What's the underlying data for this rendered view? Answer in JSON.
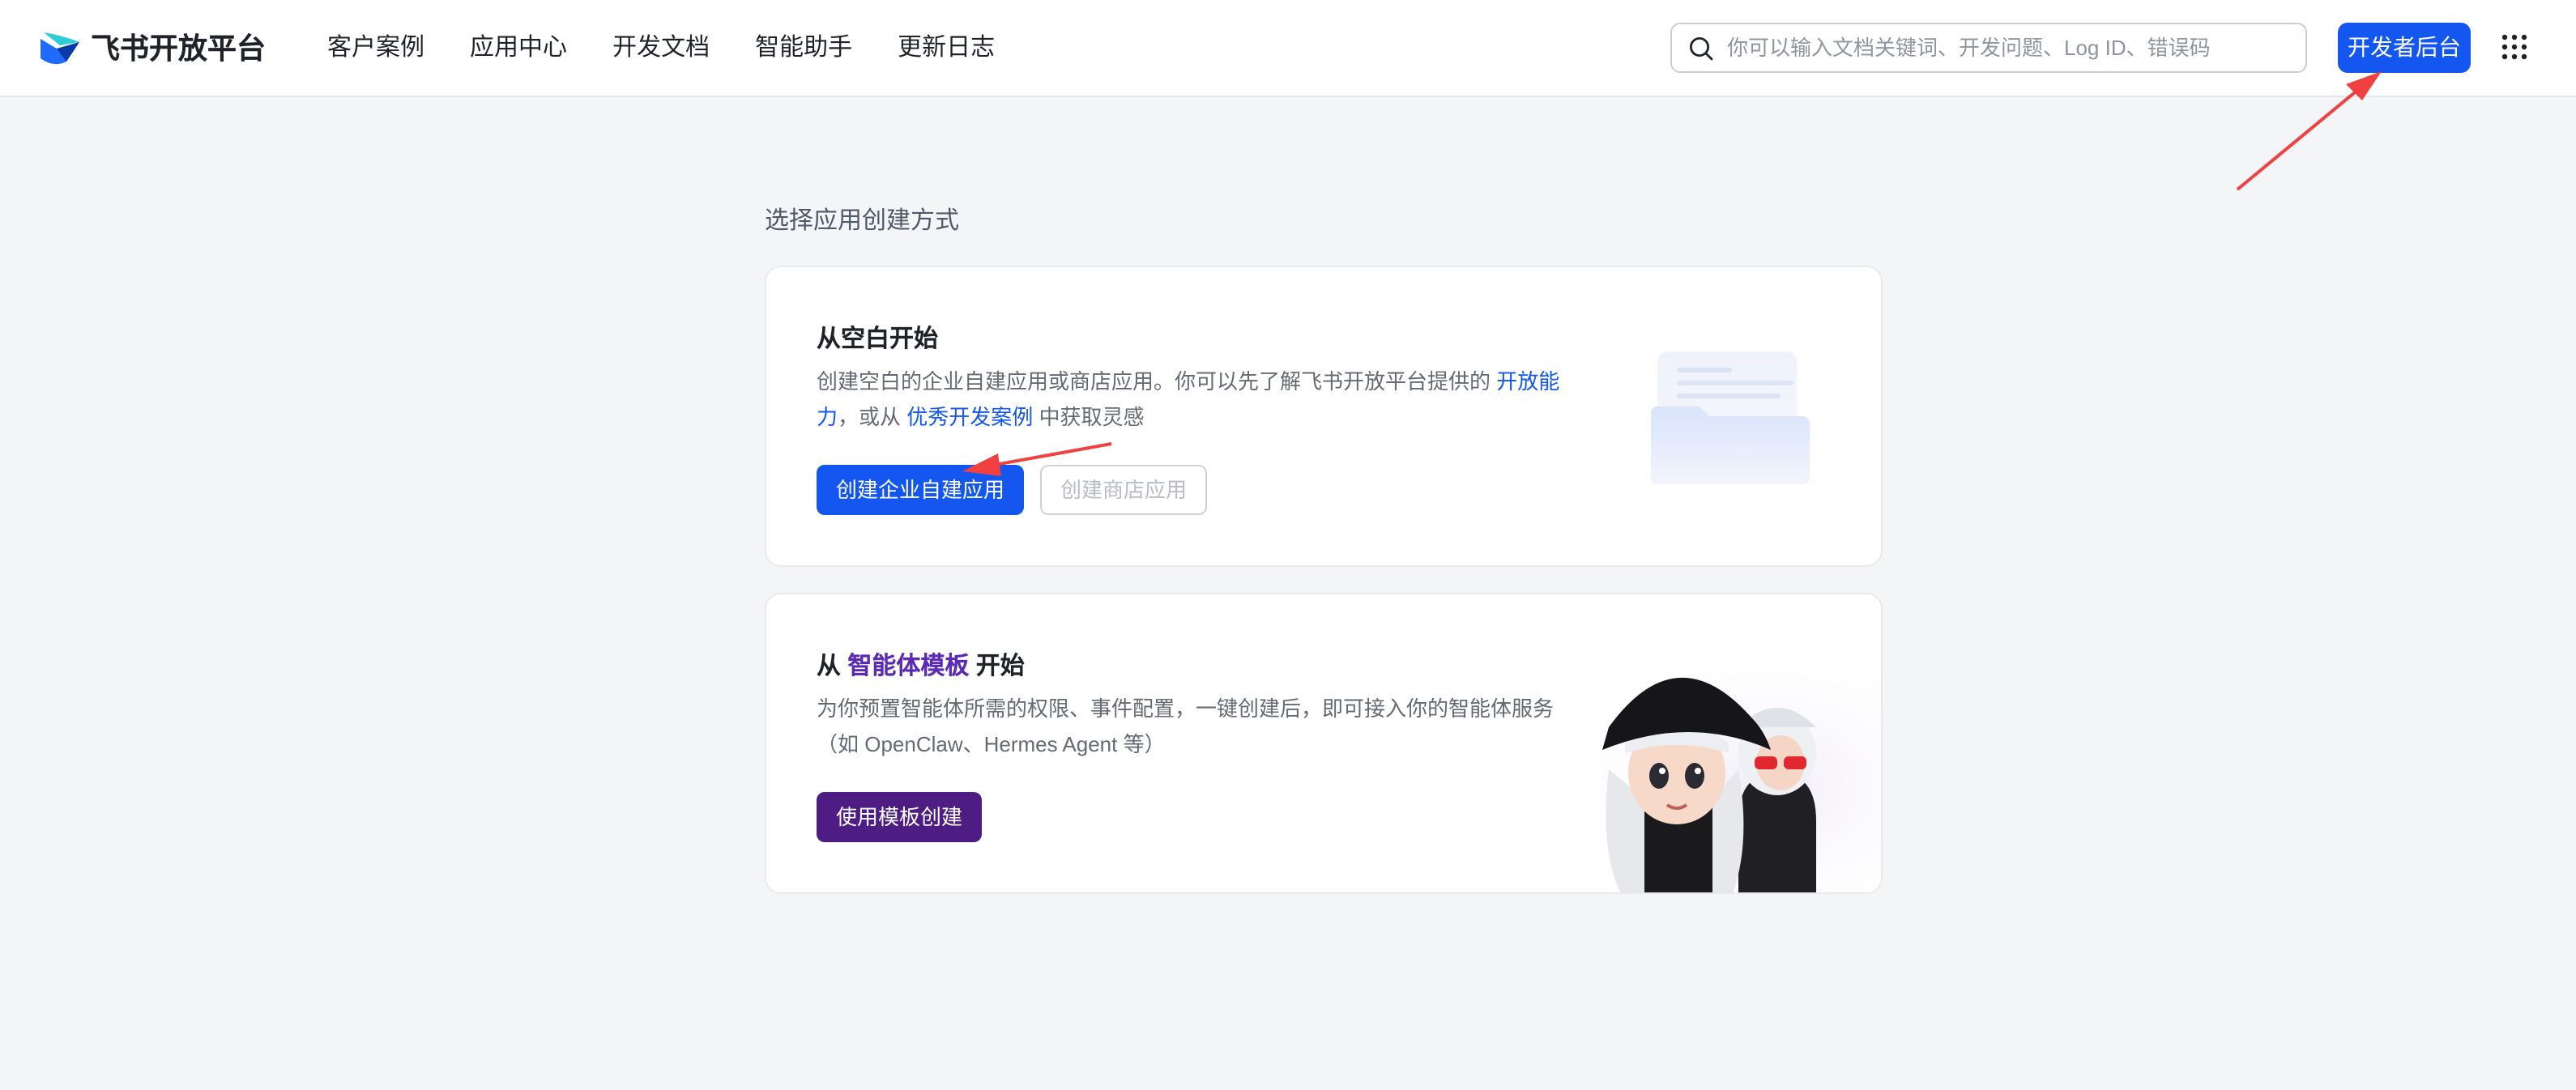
{
  "header": {
    "brand": "飞书开放平台",
    "nav": [
      "客户案例",
      "应用中心",
      "开发文档",
      "智能助手",
      "更新日志"
    ],
    "search_placeholder": "你可以输入文档关键词、开发问题、Log ID、错误码",
    "dev_console_label": "开发者后台"
  },
  "main": {
    "section_title": "选择应用创建方式",
    "blank_card": {
      "title": "从空白开始",
      "desc_prefix": "创建空白的企业自建应用或商店应用。你可以先了解飞书开放平台提供的 ",
      "link1": "开放能力",
      "desc_middle": "，或从 ",
      "link2": "优秀开发案例",
      "desc_suffix": " 中获取灵感",
      "primary_button": "创建企业自建应用",
      "secondary_button": "创建商店应用"
    },
    "template_card": {
      "title_prefix": "从 ",
      "title_highlight": "智能体模板",
      "title_suffix": " 开始",
      "desc": "为你预置智能体所需的权限、事件配置，一键创建后，即可接入你的智能体服务（如 OpenClaw、Hermes Agent 等）",
      "button": "使用模板创建"
    }
  },
  "colors": {
    "primary": "#1456f0",
    "purple": "#4e1d84",
    "annotation_arrow": "#f04040"
  }
}
